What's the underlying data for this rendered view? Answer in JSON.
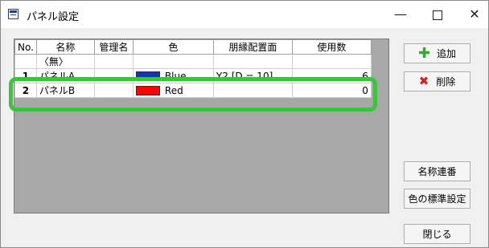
{
  "window": {
    "title": "パネル設定",
    "minimize": "—",
    "close": "✕"
  },
  "grid": {
    "columns": [
      "No.",
      "名称",
      "管理名",
      "色",
      "朋縁配置面",
      "使用数"
    ],
    "rows": [
      {
        "no": "",
        "name": "〈無〉",
        "manage": "",
        "color_label": "",
        "color_hex": "",
        "face": "",
        "count": ""
      },
      {
        "no": "1",
        "name": "パネルA",
        "manage": "",
        "color_label": "Blue",
        "color_hex": "#1a2fb8",
        "face": "Y2 [D = 10]",
        "count": "6"
      },
      {
        "no": "2",
        "name": "パネルB",
        "manage": "",
        "color_label": "Red",
        "color_hex": "#ff0000",
        "face": "",
        "count": "0"
      }
    ]
  },
  "buttons": {
    "add": "追加",
    "delete": "削除",
    "rename_seq": "名称連番",
    "default_color": "色の標準設定",
    "close": "閉じる"
  },
  "colors": {
    "highlight": "#3bc43b",
    "add_icon": "#3aa53a",
    "delete_icon": "#d32020"
  }
}
